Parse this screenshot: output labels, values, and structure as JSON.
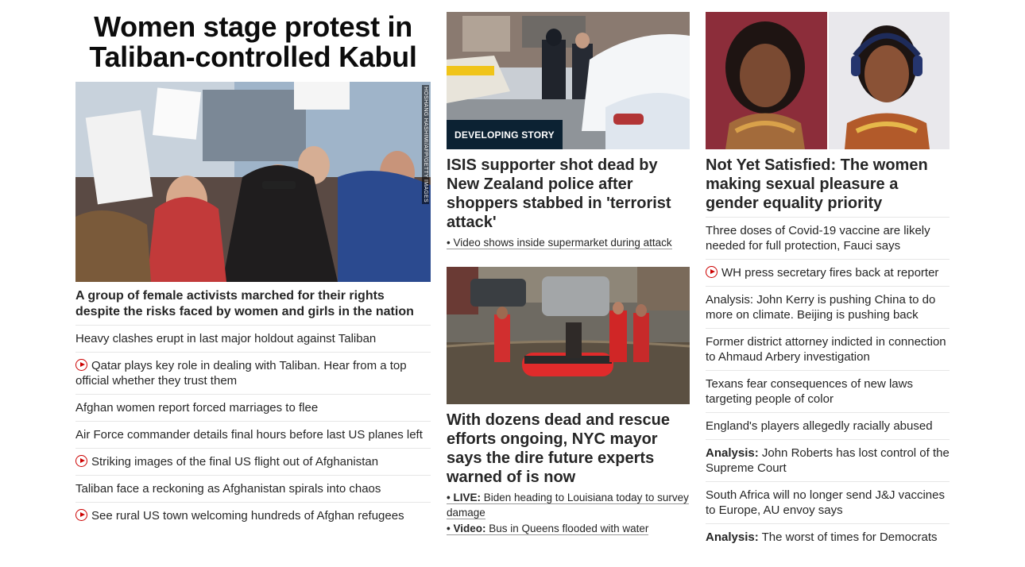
{
  "lead": {
    "title": "Women stage protest in Taliban-controlled Kabul",
    "photo_credit": "HOSHANG HASHIMI/AFP/GETTY IMAGES",
    "caption": "A group of female activists marched for their rights despite the risks faced by women and girls in the nation",
    "links": [
      {
        "text": "Heavy clashes erupt in last major holdout against Taliban",
        "video": false
      },
      {
        "text": "Qatar plays key role in dealing with Taliban. Hear from a top official whether they trust them",
        "video": true
      },
      {
        "text": "Afghan women report forced marriages to flee",
        "video": false
      },
      {
        "text": "Air Force commander details final hours before last US planes left",
        "video": false
      },
      {
        "text": "Striking images of the final US flight out of Afghanistan",
        "video": true
      },
      {
        "text": "Taliban face a reckoning as Afghanistan spirals into chaos",
        "video": false
      },
      {
        "text": "See rural US town welcoming hundreds of Afghan refugees",
        "video": true
      }
    ]
  },
  "middle": {
    "story1": {
      "badge": "DEVELOPING STORY",
      "headline": "ISIS supporter shot dead by New Zealand police after shoppers stabbed in 'terrorist attack'",
      "sub": "• Video shows inside supermarket during attack"
    },
    "story2": {
      "headline": "With dozens dead and rescue efforts ongoing, NYC mayor says the dire future experts warned of is now",
      "subs": [
        {
          "prefix": "• LIVE:",
          "text": " Biden heading to Louisiana today to survey damage"
        },
        {
          "prefix": "• Video:",
          "text": " Bus in Queens flooded with water"
        }
      ]
    }
  },
  "right": {
    "headline": "Not Yet Satisfied: The women making sexual pleasure a gender equality priority",
    "links": [
      {
        "prefix": "",
        "text": "Three doses of Covid-19 vaccine are likely needed for full protection, Fauci says",
        "video": false
      },
      {
        "prefix": "",
        "text": "WH press secretary fires back at reporter",
        "video": true
      },
      {
        "prefix": "",
        "text": "Analysis: John Kerry is pushing China to do more on climate. Beijing is pushing back",
        "video": false
      },
      {
        "prefix": "",
        "text": "Former district attorney indicted in connection to Ahmaud Arbery investigation",
        "video": false
      },
      {
        "prefix": "",
        "text": "Texans fear consequences of new laws targeting people of color",
        "video": false
      },
      {
        "prefix": "",
        "text": "England's players allegedly racially abused",
        "video": false
      },
      {
        "prefix": "Analysis:",
        "text": " John Roberts has lost control of the Supreme Court",
        "video": false
      },
      {
        "prefix": "",
        "text": "South Africa will no longer send J&J vaccines to Europe, AU envoy says",
        "video": false
      },
      {
        "prefix": "Analysis:",
        "text": " The worst of times for Democrats",
        "video": false
      }
    ]
  },
  "colors": {
    "video_icon": "#cc0000",
    "badge_bg": "#0c2233",
    "divider": "#e6e6e6"
  }
}
